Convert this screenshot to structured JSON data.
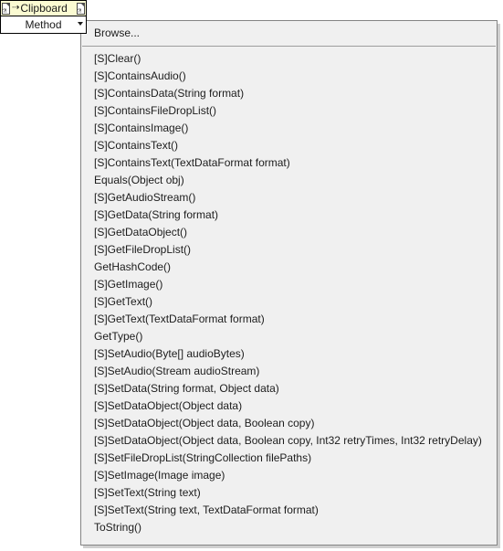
{
  "node": {
    "title": "Clipboard",
    "left_terminal_icon": "document-terminal-icon",
    "right_terminal_icon": "document-terminal-icon",
    "flow_arrow_icon": "dotted-arrow-icon",
    "method_label": "Method",
    "caret_icon": "chevron-down-icon"
  },
  "menu": {
    "browse_label": "Browse...",
    "items": [
      "[S]Clear()",
      "[S]ContainsAudio()",
      "[S]ContainsData(String format)",
      "[S]ContainsFileDropList()",
      "[S]ContainsImage()",
      "[S]ContainsText()",
      "[S]ContainsText(TextDataFormat format)",
      "Equals(Object obj)",
      "[S]GetAudioStream()",
      "[S]GetData(String format)",
      "[S]GetDataObject()",
      "[S]GetFileDropList()",
      "GetHashCode()",
      "[S]GetImage()",
      "[S]GetText()",
      "[S]GetText(TextDataFormat format)",
      "GetType()",
      "[S]SetAudio(Byte[] audioBytes)",
      "[S]SetAudio(Stream audioStream)",
      "[S]SetData(String format, Object data)",
      "[S]SetDataObject(Object data)",
      "[S]SetDataObject(Object data, Boolean copy)",
      "[S]SetDataObject(Object data, Boolean copy, Int32 retryTimes, Int32 retryDelay)",
      "[S]SetFileDropList(StringCollection filePaths)",
      "[S]SetImage(Image image)",
      "[S]SetText(String text)",
      "[S]SetText(String text, TextDataFormat format)",
      "ToString()"
    ]
  },
  "colors": {
    "node_title_background": "#fbfbd2",
    "menu_background": "#f0f0f0",
    "menu_border": "#848484",
    "separator": "#9d9d9d",
    "text": "#1c1c1c"
  }
}
